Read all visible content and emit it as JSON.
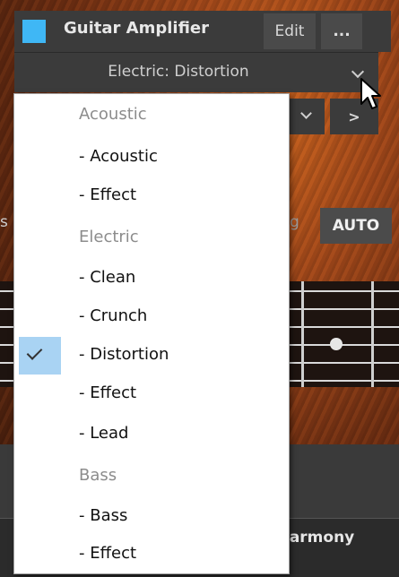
{
  "header": {
    "title": "Guitar Amplifier",
    "edit_label": "Edit",
    "more_label": "...",
    "swatch_color": "#3fb7f5"
  },
  "preset": {
    "current": "Electric: Distortion"
  },
  "sub_bar": {
    "next_label": ">"
  },
  "controls": {
    "auto_label": "AUTO",
    "partial_left": "s",
    "partial_right": "g",
    "harmony_partial": "larmony"
  },
  "menu": {
    "items": [
      {
        "label": "Acoustic",
        "kind": "group"
      },
      {
        "label": "- Acoustic",
        "kind": "item"
      },
      {
        "label": "- Effect",
        "kind": "item"
      },
      {
        "label": "Electric",
        "kind": "group"
      },
      {
        "label": "- Clean",
        "kind": "item"
      },
      {
        "label": "- Crunch",
        "kind": "item"
      },
      {
        "label": "- Distortion",
        "kind": "item",
        "selected": true
      },
      {
        "label": "- Effect",
        "kind": "item"
      },
      {
        "label": "- Lead",
        "kind": "item"
      },
      {
        "label": "Bass",
        "kind": "group"
      },
      {
        "label": "- Bass",
        "kind": "item"
      },
      {
        "label": "- Effect",
        "kind": "item"
      }
    ]
  }
}
